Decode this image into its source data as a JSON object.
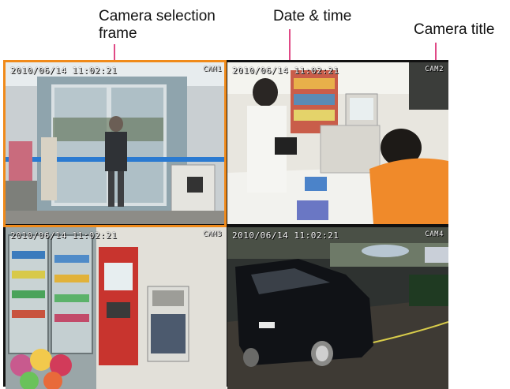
{
  "callouts": {
    "selection_frame": "Camera selection\nframe",
    "date_time": "Date & time",
    "camera_title": "Camera title"
  },
  "colors": {
    "selection_frame": "#f08a1a",
    "leader_line": "#e04a86"
  },
  "cameras": [
    {
      "timestamp": "2010/06/14 11:02:21",
      "title": "CAM1",
      "scene": "store entrance glass doors"
    },
    {
      "timestamp": "2010/06/14 11:02:21",
      "title": "CAM2",
      "scene": "checkout counter"
    },
    {
      "timestamp": "2010/06/14 11:02:21",
      "title": "CAM3",
      "scene": "refrigerated aisle and ATM"
    },
    {
      "timestamp": "2010/06/14 11:02:21",
      "title": "CAM4",
      "scene": "parking lot at night"
    }
  ],
  "selected_camera_index": 0
}
